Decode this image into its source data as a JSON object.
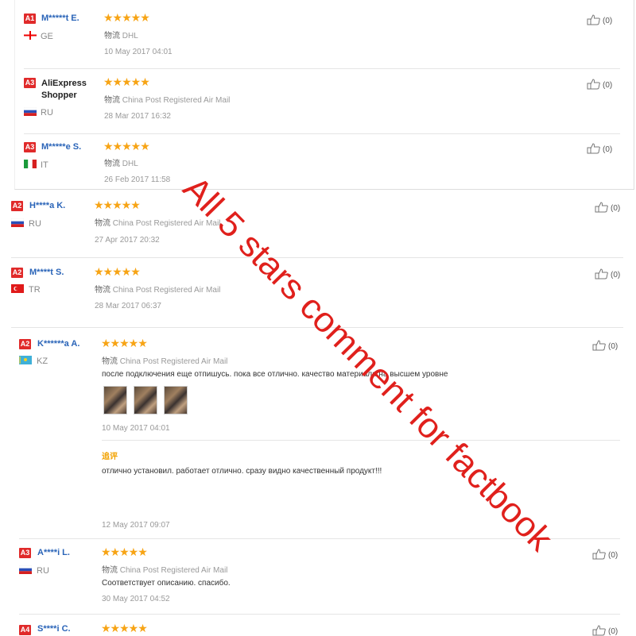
{
  "helpful_label": "(0)",
  "ship_prefix": "物流",
  "stars": "★★★★★",
  "reviews": [
    {
      "badge": "A1",
      "name": "M*****t E.",
      "country": "GE",
      "shipping": "DHL",
      "date": "10 May 2017 04:01"
    },
    {
      "badge": "A3",
      "name": "AliExpress Shopper",
      "country": "RU",
      "shipping": "China Post Registered Air Mail",
      "date": "28 Mar 2017 16:32"
    },
    {
      "badge": "A3",
      "name": "M*****e S.",
      "country": "IT",
      "shipping": "DHL",
      "date": "26 Feb 2017 11:58"
    },
    {
      "badge": "A2",
      "name": "H****a K.",
      "country": "RU",
      "shipping": "China Post Registered Air Mail",
      "date": "27 Apr 2017 20:32"
    },
    {
      "badge": "A2",
      "name": "M****t S.",
      "country": "TR",
      "shipping": "China Post Registered Air Mail",
      "date": "28 Mar 2017 06:37"
    },
    {
      "badge": "A2",
      "name": "K******a A.",
      "country": "KZ",
      "shipping": "China Post Registered Air Mail",
      "comment": "после подключения еще отпишусь. пока все отлично. качество материала на высшем уровне",
      "date": "10 May 2017 04:01",
      "followup_label": "追评",
      "followup_text": "отлично установил. работает отлично. сразу видно качественный продукт!!!",
      "followup_date": "12 May 2017 09:07"
    },
    {
      "badge": "A3",
      "name": "A****i L.",
      "country": "RU",
      "shipping": "China Post Registered Air Mail",
      "comment": "Соответствует описанию. спасибо.",
      "date": "30 May 2017 04:52"
    },
    {
      "badge": "A4",
      "name": "S****i C.",
      "country": "",
      "shipping": "",
      "date": ""
    }
  ],
  "overlay_text": "All 5 stars comment for factbook",
  "colors": {
    "badge": "#e02a2a",
    "star": "#f7a415",
    "name": "#2a64b8",
    "overlay": "#e0201c",
    "followup": "#f2a200"
  }
}
